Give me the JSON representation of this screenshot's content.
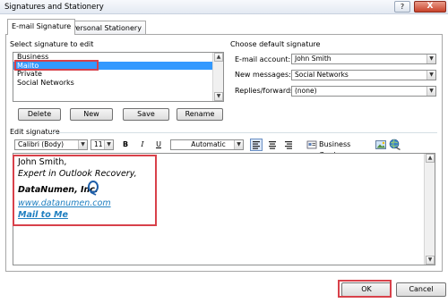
{
  "window": {
    "title": "Signatures and Stationery",
    "help_glyph": "?",
    "close_glyph": "X"
  },
  "tabs": [
    {
      "label": "E-mail Signature",
      "active": true
    },
    {
      "label": "Personal Stationery",
      "active": false
    }
  ],
  "select_signature": {
    "label": "Select signature to edit",
    "items": [
      "Business",
      "Mailto",
      "Private",
      "Social Networks"
    ],
    "selected": "Mailto"
  },
  "sig_buttons": {
    "delete": "Delete",
    "new": "New",
    "save": "Save",
    "rename": "Rename"
  },
  "default_signature": {
    "label": "Choose default signature",
    "email_account_label": "E-mail account:",
    "email_account_value": "John Smith",
    "new_messages_label": "New messages:",
    "new_messages_value": "Social Networks",
    "replies_label": "Replies/forwards:",
    "replies_value": "(none)"
  },
  "edit_signature": {
    "label": "Edit signature",
    "font": "Calibri (Body)",
    "size": "11",
    "bold": "B",
    "italic": "I",
    "underline": "U",
    "color": "Automatic",
    "business_card": "Business Card"
  },
  "signature_content": {
    "line1": "John Smith,",
    "line2": "Expert in Outlook Recovery,",
    "company": "DataNumen, Inc.",
    "website": "www.datanumen.com",
    "mail_link": "Mail to Me"
  },
  "footer": {
    "ok": "OK",
    "cancel": "Cancel"
  },
  "colors": {
    "selection": "#3399ff",
    "highlight_box": "#d8414a",
    "link": "#1f7fc0"
  }
}
